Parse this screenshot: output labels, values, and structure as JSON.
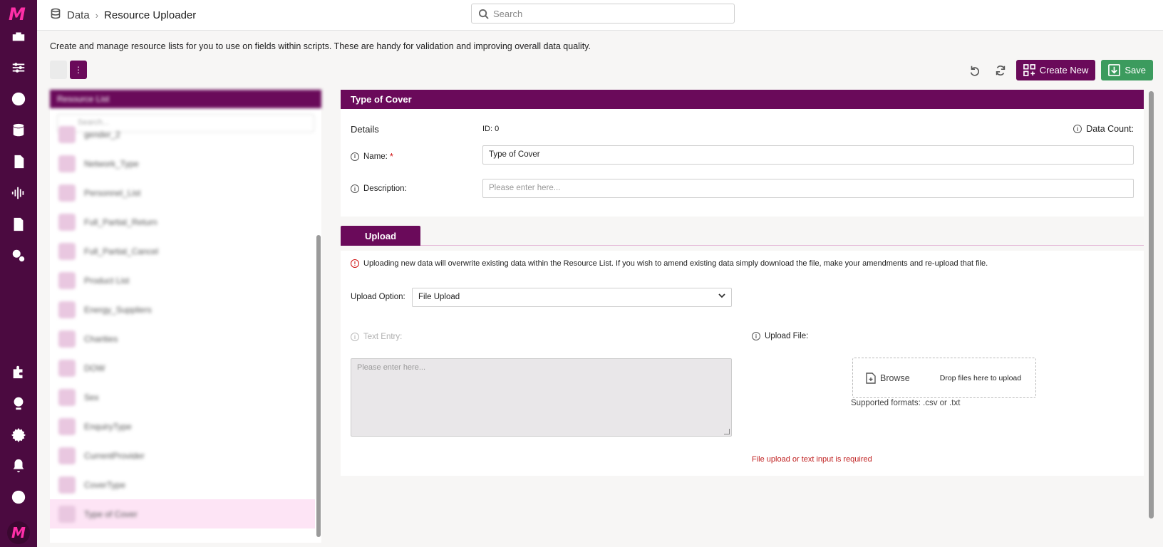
{
  "nav": {
    "logo": "M",
    "bottom_logo": "M",
    "icons": [
      "toolbox-icon",
      "sliders-icon",
      "dashboard-icon",
      "database-icon",
      "file-search-icon",
      "audio-wave-icon",
      "report-icon",
      "cogs-icon",
      "puzzle-icon",
      "globe-icon",
      "gear-icon",
      "bell-icon",
      "help-icon"
    ]
  },
  "breadcrumb": {
    "root": "Data",
    "separator": "›",
    "current": "Resource Uploader"
  },
  "search": {
    "placeholder": "Search"
  },
  "intro": "Create and manage resource lists for you to use on fields within scripts. These are handy for validation and improving overall data quality.",
  "toolbar": {
    "create_label": "Create New",
    "save_label": "Save"
  },
  "resource_list": {
    "header": "Resource List",
    "search_placeholder": "Search...",
    "items": [
      {
        "label": "gender_2"
      },
      {
        "label": "Network_Type"
      },
      {
        "label": "Personnel_List"
      },
      {
        "label": "Full_Partial_Return"
      },
      {
        "label": "Full_Partial_Cancel"
      },
      {
        "label": "Product List"
      },
      {
        "label": "Energy_Suppliers"
      },
      {
        "label": "Charities"
      },
      {
        "label": "DOW"
      },
      {
        "label": "Sex"
      },
      {
        "label": "EnquiryType"
      },
      {
        "label": "CurrentProvider"
      },
      {
        "label": "CoverType"
      },
      {
        "label": "Type of Cover"
      }
    ]
  },
  "detail": {
    "title": "Type of Cover",
    "details_label": "Details",
    "id_text": "ID: 0",
    "data_count_label": "Data Count:",
    "name_label": "Name:",
    "name_required": "*",
    "name_value": "Type of Cover",
    "description_label": "Description:",
    "description_placeholder": "Please enter here..."
  },
  "upload": {
    "tab_label": "Upload",
    "warning": "Uploading new data will overwrite existing data within the Resource List. If you wish to amend existing data simply download the file, make your amendments and re-upload that file.",
    "option_label": "Upload Option:",
    "option_value": "File Upload",
    "text_entry_label": "Text Entry:",
    "text_entry_placeholder": "Please enter here...",
    "upload_file_label": "Upload File:",
    "browse_label": "Browse",
    "drop_text": "Drop files here to upload",
    "formats": "Supported formats: .csv or .txt",
    "error": "File upload or text input is required"
  },
  "colors": {
    "brand": "#6a0a5a",
    "rail": "#4b0a40",
    "save": "#3c9b5e",
    "error": "#c02020",
    "accent_pink": "#ff2fa8"
  }
}
